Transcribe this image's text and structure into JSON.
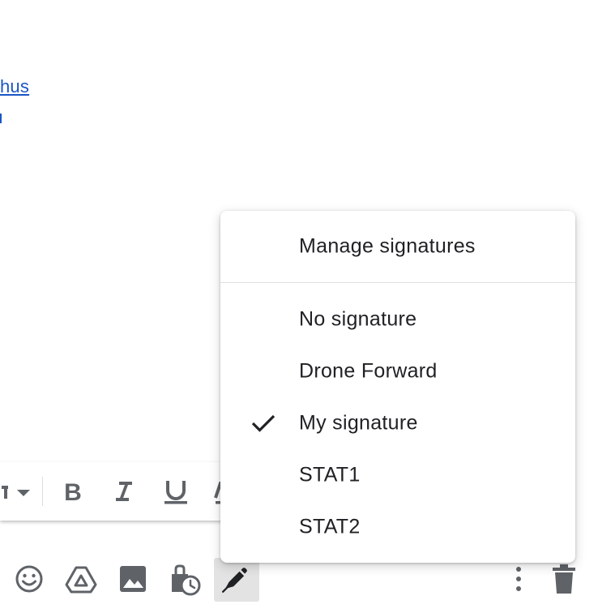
{
  "email_body": {
    "link_fragment": "hus"
  },
  "signature_menu": {
    "manage_label": "Manage signatures",
    "items": [
      {
        "label": "No signature",
        "selected": false
      },
      {
        "label": "Drone Forward",
        "selected": false
      },
      {
        "label": "My signature",
        "selected": true
      },
      {
        "label": "STAT1",
        "selected": false
      },
      {
        "label": "STAT2",
        "selected": false
      }
    ]
  },
  "format_toolbar": {
    "icons": [
      "text-color-dropdown-icon",
      "bold-icon",
      "italic-icon",
      "underline-icon"
    ]
  },
  "action_bar": {
    "icons": [
      "emoji-icon",
      "drive-icon",
      "insert-photo-icon",
      "schedule-send-icon",
      "signature-pen-icon",
      "more-options-icon",
      "delete-icon"
    ],
    "active": "signature-pen-icon"
  },
  "colors": {
    "link": "#1a55c4",
    "icon": "#5f6368",
    "menu_text": "#202124",
    "active_button_bg": "#e3e3e3"
  }
}
